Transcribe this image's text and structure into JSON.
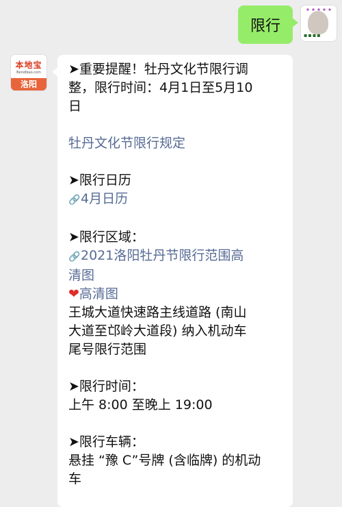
{
  "user_message": {
    "text": "限行"
  },
  "bot": {
    "avatar": {
      "brand": "本地宝",
      "url": "Bendibao.com",
      "city": "洛阳"
    },
    "lines": [
      {
        "t": "➤重要提醒！牡丹文化节限行调"
      },
      {
        "t": "整，限行时间：4月1日至5月10"
      },
      {
        "t": "日"
      },
      {
        "t": ""
      },
      {
        "t": "牡丹文化节限行规定",
        "link": true
      },
      {
        "t": ""
      },
      {
        "t": "➤限行日历"
      },
      {
        "t": "4月日历",
        "link": true,
        "chain": true
      },
      {
        "t": ""
      },
      {
        "t": "➤限行区域："
      },
      {
        "t": "2021洛阳牡丹节限行范围高",
        "link": true,
        "chain": true
      },
      {
        "t": "清图",
        "link": true
      },
      {
        "t": "高清图",
        "link": true,
        "heart": true
      },
      {
        "t": "王城大道快速路主线道路 (南山"
      },
      {
        "t": "大道至邙岭大道段) 纳入机动车"
      },
      {
        "t": "尾号限行范围"
      },
      {
        "t": ""
      },
      {
        "t": "➤限行时间："
      },
      {
        "t": "上午 8:00 至晚上 19:00"
      },
      {
        "t": ""
      },
      {
        "t": "➤限行车辆："
      },
      {
        "t": "悬挂 “豫 C”号牌 (含临牌) 的机动"
      },
      {
        "t": "车"
      }
    ]
  }
}
